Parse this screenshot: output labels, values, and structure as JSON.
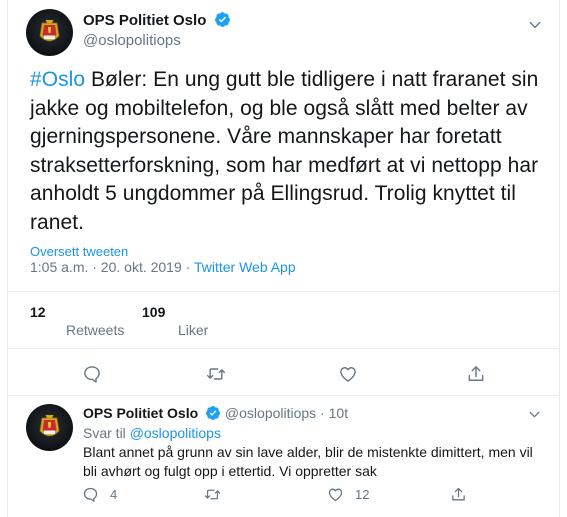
{
  "tweet": {
    "author_name": "OPS Politiet Oslo",
    "author_handle": "@oslopolitiops",
    "hashtag": "#Oslo",
    "text": " Bøler: En ung gutt ble tidligere i natt fraranet sin jakke og mobiltelefon, og ble også slått med belter av gjerningspersonene. Våre mannskaper har foretatt straksetterforskning, som har medført at vi nettopp har anholdt 5 ungdommer på Ellingsrud. Trolig knyttet til ranet.",
    "translate_label": "Oversett tweeten",
    "timestamp": "1:05 a.m. · 20. okt. 2019 · ",
    "app": "Twitter Web App",
    "retweets_count": "12",
    "retweets_label": "Retweets",
    "likes_count": "109",
    "likes_label": "Liker"
  },
  "reply": {
    "author_name": "OPS Politiet Oslo",
    "author_handle": "@oslopolitiops",
    "time": " · 10t",
    "reply_to_prefix": "Svar til ",
    "reply_to_handle": "@oslopolitiops",
    "text": "Blant annet på grunn av sin lave alder, blir de mistenkte dimittert, men vil bli avhørt og fulgt opp i ettertid. Vi oppretter sak",
    "reply_count": "4",
    "like_count": "12"
  },
  "colors": {
    "accent": "#1b95e0",
    "secondary_text": "#657786",
    "divider": "#e6ecf0",
    "icon": "#657786"
  },
  "icons": [
    "verified-badge-icon",
    "chevron-down-icon",
    "reply-icon",
    "retweet-icon",
    "like-icon",
    "share-icon",
    "police-badge-avatar"
  ]
}
